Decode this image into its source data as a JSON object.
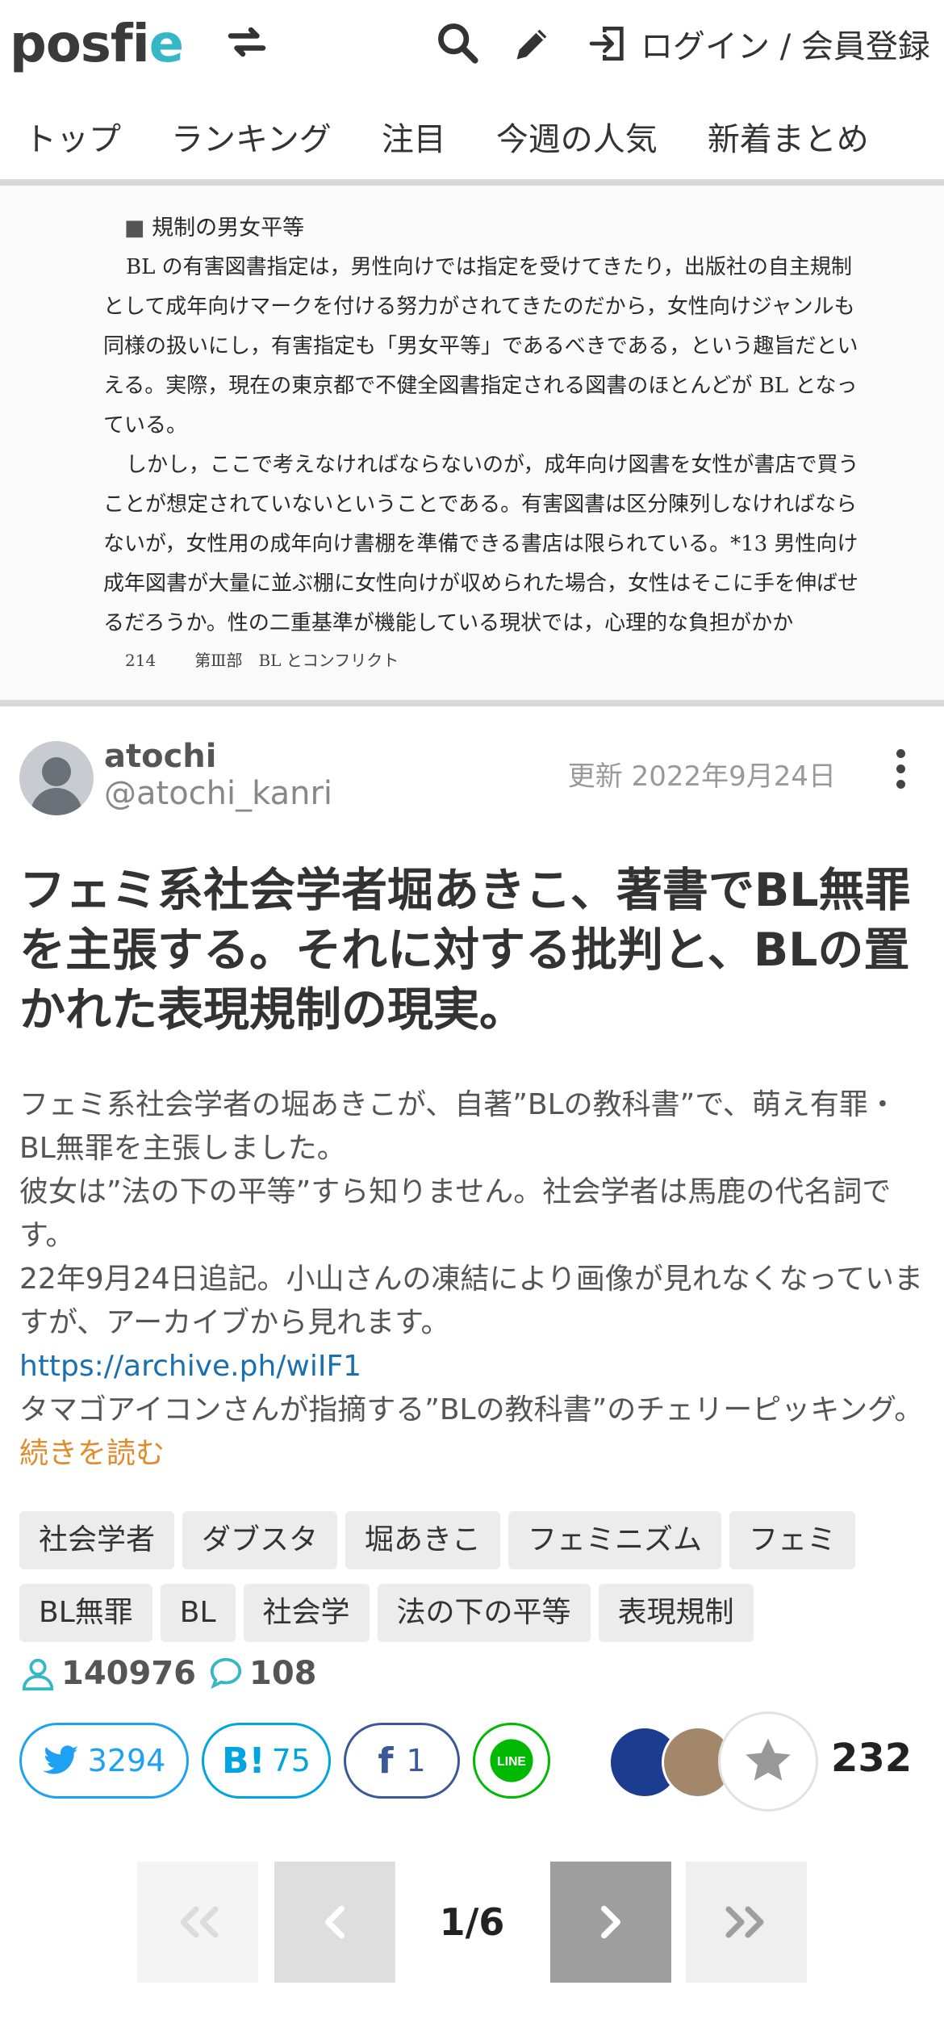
{
  "header": {
    "logo_pre": "posfi",
    "logo_e": "e",
    "login_label": "ログイン / 会員登録"
  },
  "nav": {
    "items": [
      "トップ",
      "ランキング",
      "注目",
      "今週の人気",
      "新着まとめ"
    ]
  },
  "scan": {
    "heading": "規制の男女平等",
    "p1": "BL の有害図書指定は，男性向けでは指定を受けてきたり，出版社の自主規制として成年向けマークを付ける努力がされてきたのだから，女性向けジャンルも同様の扱いにし，有害指定も「男女平等」であるべきである，という趣旨だといえる。実際，現在の東京都で不健全図書指定される図書のほとんどが BL となっている。",
    "p2": "しかし，ここで考えなければならないのが，成年向け図書を女性が書店で買うことが想定されていないということである。有害図書は区分陳列しなければならないが，女性用の成年向け書棚を準備できる書店は限られている。*13 男性向け成年図書が大量に並ぶ棚に女性向けが収められた場合，女性はそこに手を伸ばせるだろうか。性の二重基準が機能している現状では，心理的な負担がかか",
    "page_num": "214",
    "section": "第Ⅲ部　BL とコンフリクト"
  },
  "author": {
    "name": "atochi",
    "handle": "@atochi_kanri",
    "updated": "更新 2022年9月24日"
  },
  "article": {
    "title": "フェミ系社会学者堀あきこ、著書でBL無罪を主張する。それに対する批判と、BLの置かれた表現規制の現実。",
    "desc1": "フェミ系社会学者の堀あきこが、自著”BLの教科書”で、萌え有罪・BL無罪を主張しました。",
    "desc2": "彼女は”法の下の平等”すら知りません。社会学者は馬鹿の代名詞です。",
    "desc3": "22年9月24日追記。小山さんの凍結により画像が見れなくなっていますが、アーカイブから見れます。",
    "link": "https://archive.ph/wiIF1",
    "desc4": "タマゴアイコンさんが指摘する”BLの教科書”のチェリーピッキング。",
    "more": "続きを読む"
  },
  "tags": [
    "社会学者",
    "ダブスタ",
    "堀あきこ",
    "フェミニズム",
    "フェミ",
    "BL無罪",
    "BL",
    "社会学",
    "法の下の平等",
    "表現規制"
  ],
  "stats": {
    "views": "140976",
    "comments": "108"
  },
  "share": {
    "twitter": "3294",
    "hatena": "75",
    "facebook": "1",
    "line_label": "LINE",
    "favorites": "232"
  },
  "pager": {
    "label": "1/6"
  },
  "colors": {
    "accent": "#36b7c6",
    "link": "#1a6fb0",
    "more": "#e38b2c"
  }
}
